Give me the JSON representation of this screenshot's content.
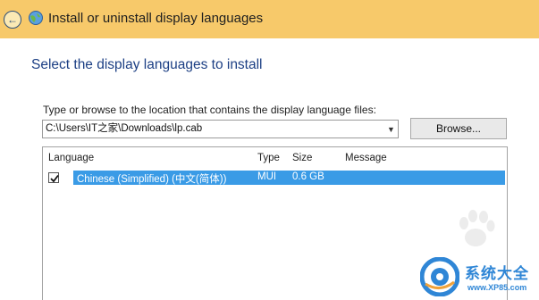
{
  "window": {
    "title": "Install or uninstall display languages",
    "back_icon": "back-arrow-icon",
    "title_icon": "language-globe-icon"
  },
  "page": {
    "heading": "Select the display languages to install"
  },
  "path": {
    "label": "Type or browse to the location that contains the display language files:",
    "value": "C:\\Users\\IT之家\\Downloads\\lp.cab",
    "browse_label": "Browse..."
  },
  "table": {
    "headers": {
      "language": "Language",
      "type": "Type",
      "size": "Size",
      "message": "Message"
    },
    "rows": [
      {
        "checked": true,
        "language": "Chinese (Simplified) (中文(简体))",
        "type": "MUI",
        "size": "0.6 GB",
        "message": ""
      }
    ]
  },
  "watermark": {
    "brand_cn": "系统大全",
    "url": "www.XP85.com",
    "accent": "#2f86d6"
  },
  "colors": {
    "titlebar": "#f7c96a",
    "heading": "#1c3f84",
    "selection": "#3a9be6"
  }
}
